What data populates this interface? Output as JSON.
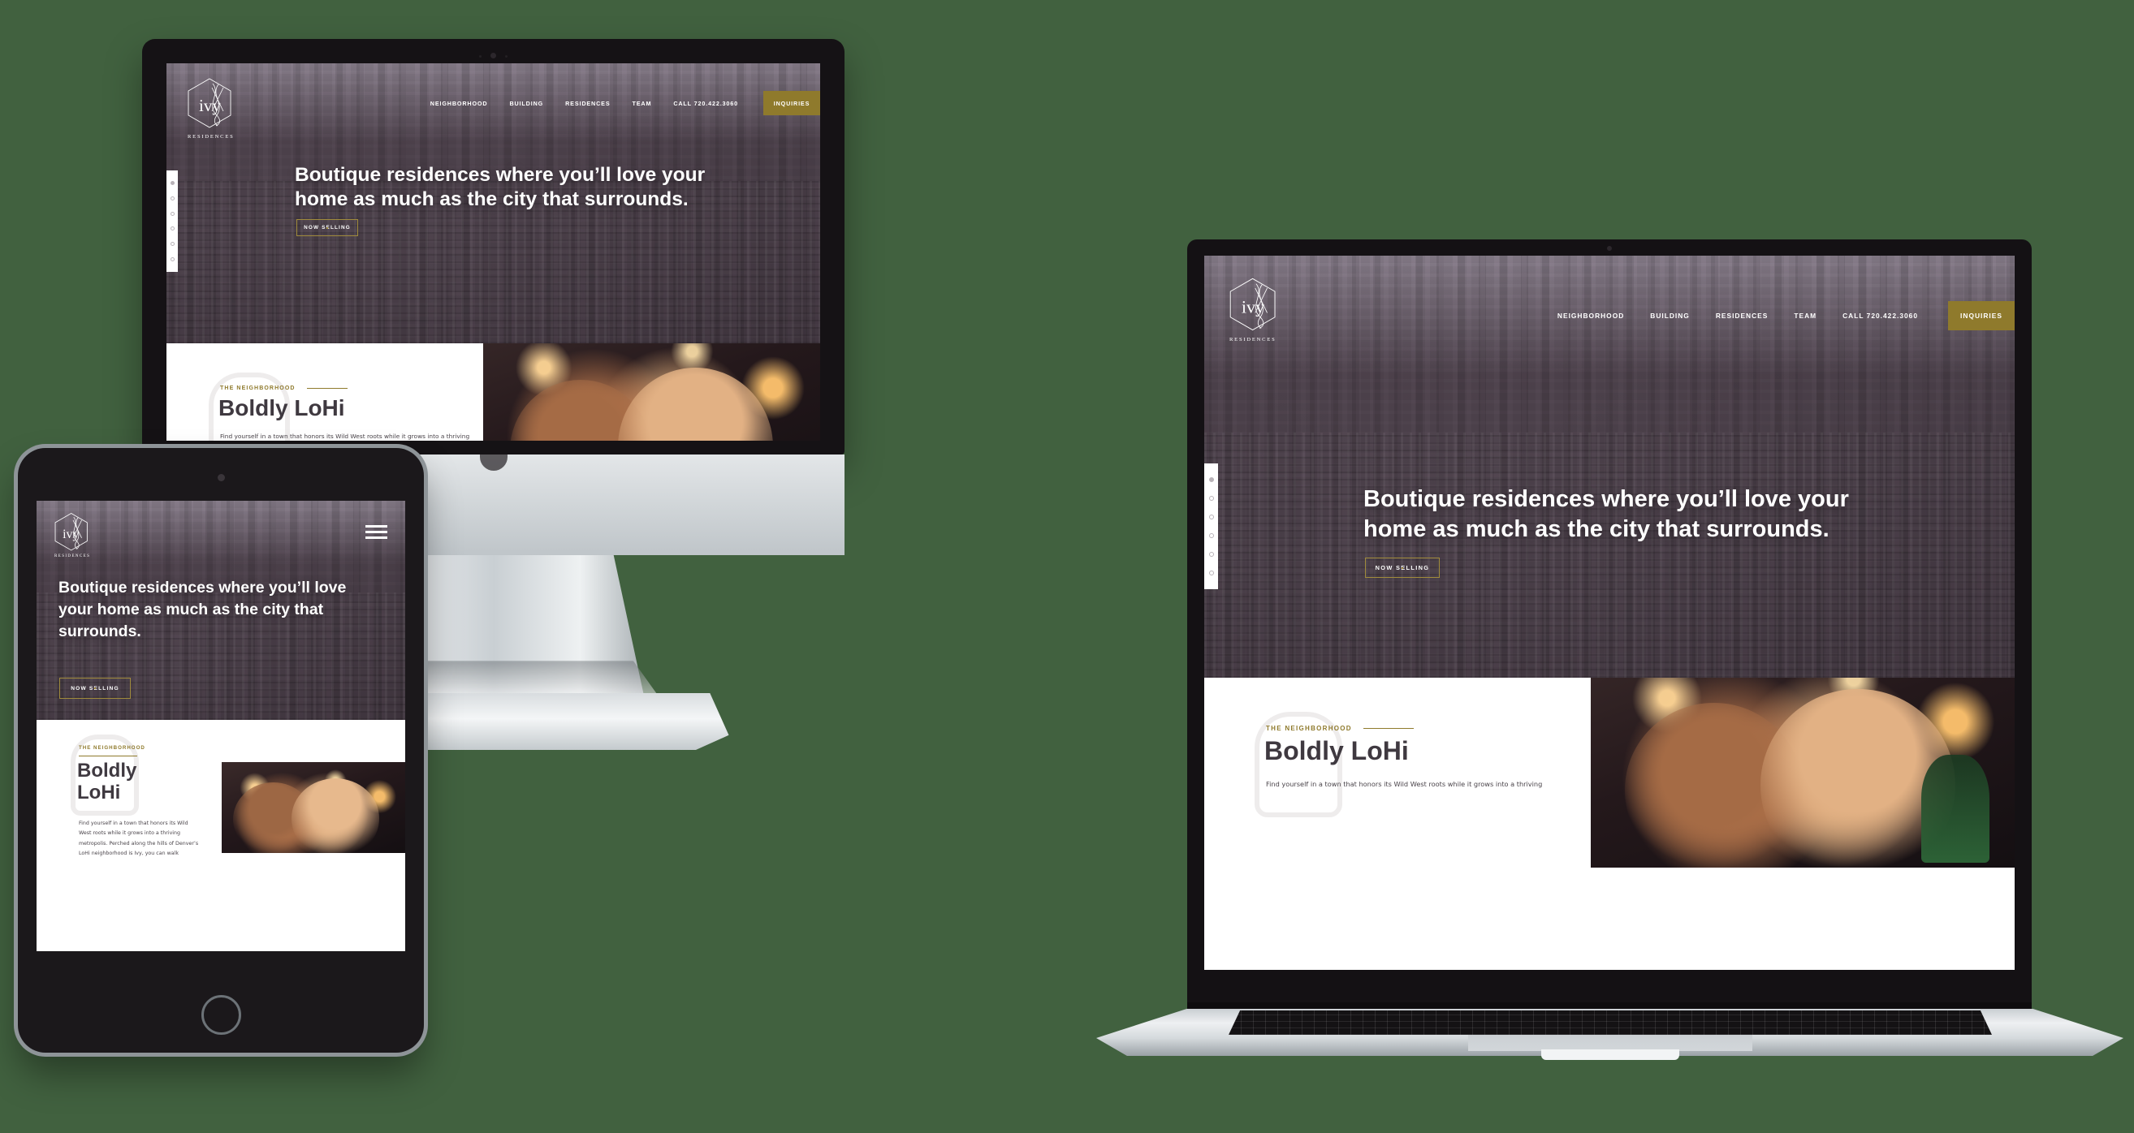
{
  "scene": {
    "background_color": "#41613f",
    "description": "Responsive web design mockup of the Ivy Residences website shown on a desktop iMac, a tablet and a laptop"
  },
  "brand": {
    "name": "ivy",
    "subtitle": "RESIDENCES",
    "accent_color": "#8f7a2c",
    "logo_icon": "hexagon-ivy-monogram-icon"
  },
  "nav": {
    "items": [
      {
        "label": "NEIGHBORHOOD"
      },
      {
        "label": "BUILDING"
      },
      {
        "label": "RESIDENCES"
      },
      {
        "label": "TEAM"
      },
      {
        "label": "CALL 720.422.3060"
      }
    ],
    "cta": {
      "label": "INQUIRIES"
    },
    "mobile_toggle_icon": "hamburger-menu-icon"
  },
  "hero": {
    "heading": "Boutique residences where you’ll love your home as much as the city that surrounds.",
    "heading_line1": "Boutique residences where you’ll love your",
    "heading_line2": "home as much as the city that surrounds.",
    "cta": {
      "label": "NOW SELLING"
    },
    "slide_dots": {
      "count": 6,
      "active_index": 0
    }
  },
  "neighborhood": {
    "eyebrow": "THE NEIGHBORHOOD",
    "title": "Boldly LoHi",
    "title_line1": "Boldly",
    "title_line2": "LoHi",
    "body": "Find yourself in a town that honors its Wild West roots while it grows into a thriving metropolis. Perched along the hills of Denver’s LoHi neighborhood is Ivy, you can walk",
    "body_desktop_line1": "Find yourself in a town that honors its Wild West roots while it grows into a thriving",
    "photo_alt": "smiling-couple-toasting-drinks-photo",
    "watermark_icon": "kettle-illustration-icon"
  },
  "devices": {
    "imac": {
      "name": "desktop-imac",
      "screen_label": "desktop view"
    },
    "tablet": {
      "name": "tablet-ipad",
      "screen_label": "tablet view"
    },
    "laptop": {
      "name": "laptop-macbook",
      "screen_label": "laptop view"
    }
  }
}
